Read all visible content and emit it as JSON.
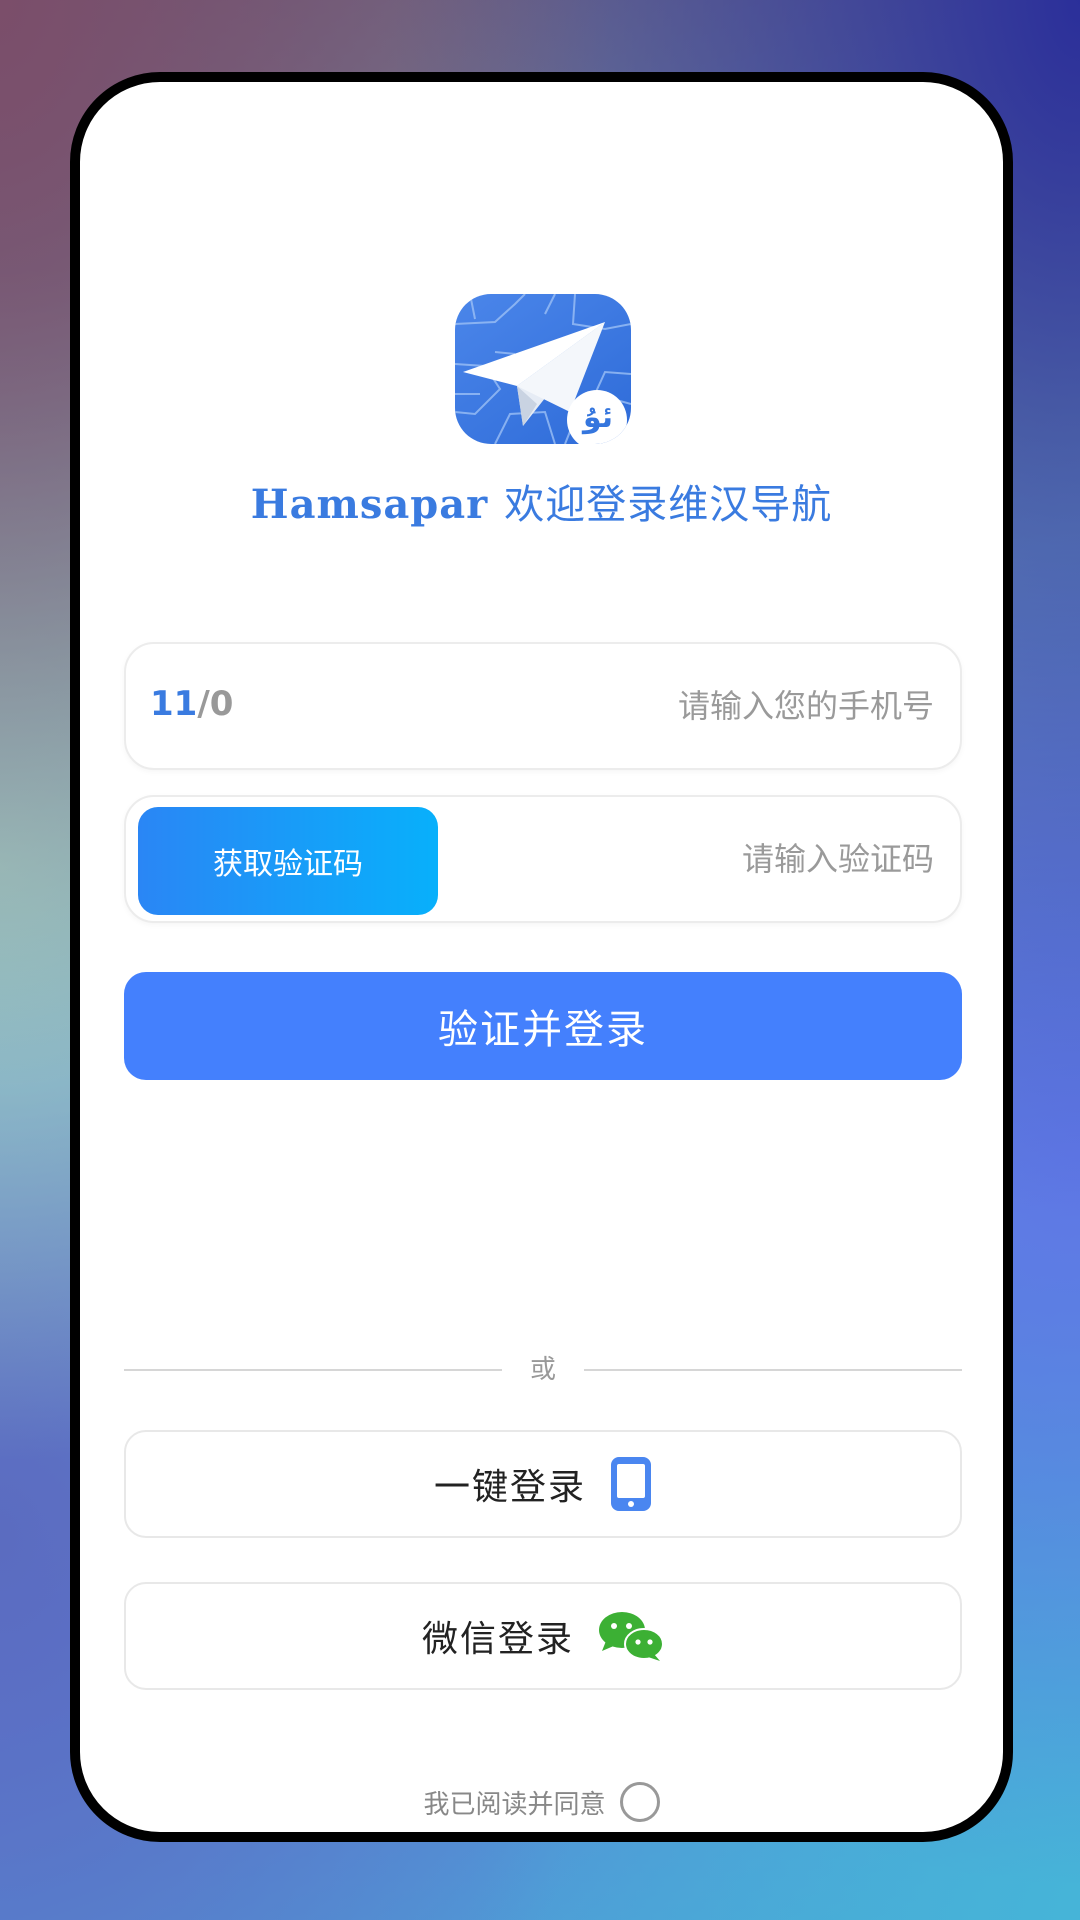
{
  "app": {
    "brand": "Hamsapar",
    "welcome": "欢迎登录维汉导航",
    "icon_badge": "ئۇ"
  },
  "phone_field": {
    "counter_max": "11",
    "counter_sep": "/",
    "counter_current": "0",
    "placeholder": "请输入您的手机号"
  },
  "code_field": {
    "button_label": "获取验证码",
    "placeholder": "请输入验证码"
  },
  "login_button": "验证并登录",
  "divider_text": "或",
  "one_click_login": {
    "label": "一键登录",
    "icon": "phone-icon"
  },
  "wechat_login": {
    "label": "微信登录",
    "icon": "wechat-icon"
  },
  "agreement": {
    "text": "我已阅读并同意",
    "checked": false
  },
  "colors": {
    "primary": "#4480fd",
    "code_button_start": "#2a86f5",
    "code_button_end": "#08b0fb",
    "wechat_green": "#3cb034",
    "title_blue": "#3a7be0"
  }
}
